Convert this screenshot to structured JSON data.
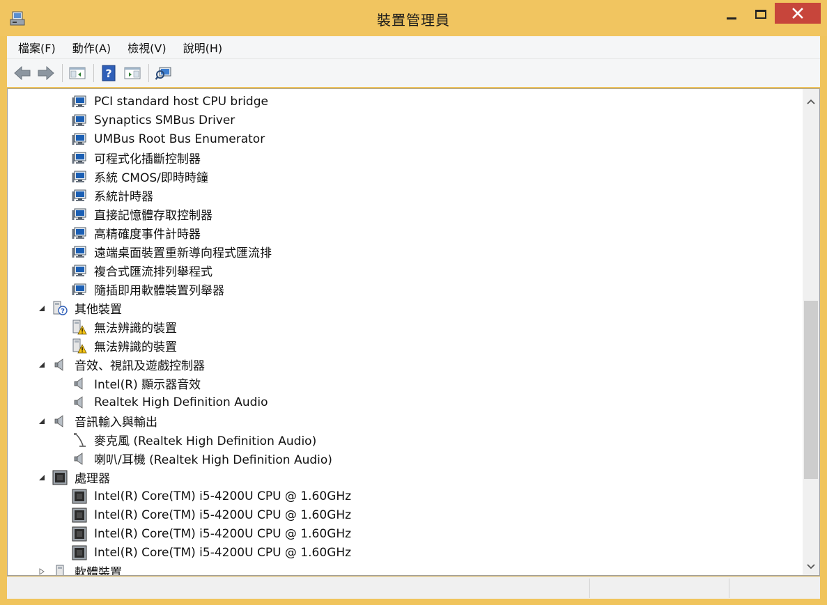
{
  "window": {
    "title": "裝置管理員",
    "icon": "device-manager-icon"
  },
  "menu": [
    {
      "label": "檔案(F)"
    },
    {
      "label": "動作(A)"
    },
    {
      "label": "檢視(V)"
    },
    {
      "label": "說明(H)"
    }
  ],
  "toolbar": [
    {
      "name": "back-button",
      "icon": "arrow-left-icon"
    },
    {
      "name": "forward-button",
      "icon": "arrow-right-icon"
    },
    {
      "name": "show-hide-console-tree-button",
      "icon": "console-tree-icon"
    },
    {
      "name": "help-button",
      "icon": "help-icon"
    },
    {
      "name": "properties-pane-button",
      "icon": "properties-icon"
    },
    {
      "name": "scan-hardware-button",
      "icon": "scan-hardware-icon"
    }
  ],
  "tree": [
    {
      "level": 2,
      "icon": "system-device-icon",
      "label": "PCI standard host CPU bridge"
    },
    {
      "level": 2,
      "icon": "system-device-icon",
      "label": "Synaptics SMBus Driver"
    },
    {
      "level": 2,
      "icon": "system-device-icon",
      "label": "UMBus Root Bus Enumerator"
    },
    {
      "level": 2,
      "icon": "system-device-icon",
      "label": "可程式化插斷控制器"
    },
    {
      "level": 2,
      "icon": "system-device-icon",
      "label": "系統 CMOS/即時時鐘"
    },
    {
      "level": 2,
      "icon": "system-device-icon",
      "label": "系統計時器"
    },
    {
      "level": 2,
      "icon": "system-device-icon",
      "label": "直接記憶體存取控制器"
    },
    {
      "level": 2,
      "icon": "system-device-icon",
      "label": "高精確度事件計時器"
    },
    {
      "level": 2,
      "icon": "system-device-icon",
      "label": "遠端桌面裝置重新導向程式匯流排"
    },
    {
      "level": 2,
      "icon": "system-device-icon",
      "label": "複合式匯流排列舉程式"
    },
    {
      "level": 2,
      "icon": "system-device-icon",
      "label": "隨插即用軟體裝置列舉器"
    },
    {
      "level": 1,
      "icon": "unknown-device-icon",
      "label": "其他裝置",
      "expanded": true
    },
    {
      "level": 2,
      "icon": "warning-device-icon",
      "label": "無法辨識的裝置"
    },
    {
      "level": 2,
      "icon": "warning-device-icon",
      "label": "無法辨識的裝置"
    },
    {
      "level": 1,
      "icon": "speaker-icon",
      "label": "音效、視訊及遊戲控制器",
      "expanded": true
    },
    {
      "level": 2,
      "icon": "speaker-icon",
      "label": "Intel(R) 顯示器音效"
    },
    {
      "level": 2,
      "icon": "speaker-icon",
      "label": "Realtek High Definition Audio"
    },
    {
      "level": 1,
      "icon": "speaker-icon",
      "label": "音訊輸入與輸出",
      "expanded": true
    },
    {
      "level": 2,
      "icon": "microphone-icon",
      "label": "麥克風 (Realtek High Definition Audio)"
    },
    {
      "level": 2,
      "icon": "speaker-icon",
      "label": "喇叭/耳機 (Realtek High Definition Audio)"
    },
    {
      "level": 1,
      "icon": "processor-icon",
      "label": "處理器",
      "expanded": true
    },
    {
      "level": 2,
      "icon": "processor-icon",
      "label": "Intel(R) Core(TM) i5-4200U CPU @ 1.60GHz"
    },
    {
      "level": 2,
      "icon": "processor-icon",
      "label": "Intel(R) Core(TM) i5-4200U CPU @ 1.60GHz"
    },
    {
      "level": 2,
      "icon": "processor-icon",
      "label": "Intel(R) Core(TM) i5-4200U CPU @ 1.60GHz"
    },
    {
      "level": 2,
      "icon": "processor-icon",
      "label": "Intel(R) Core(TM) i5-4200U CPU @ 1.60GHz"
    },
    {
      "level": 1,
      "icon": "software-device-icon",
      "label": "軟體裝置",
      "expanded": false
    }
  ],
  "colors": {
    "frame": "#f1c560",
    "close": "#c7453b",
    "monitor_blue": "#1b5fb4"
  }
}
